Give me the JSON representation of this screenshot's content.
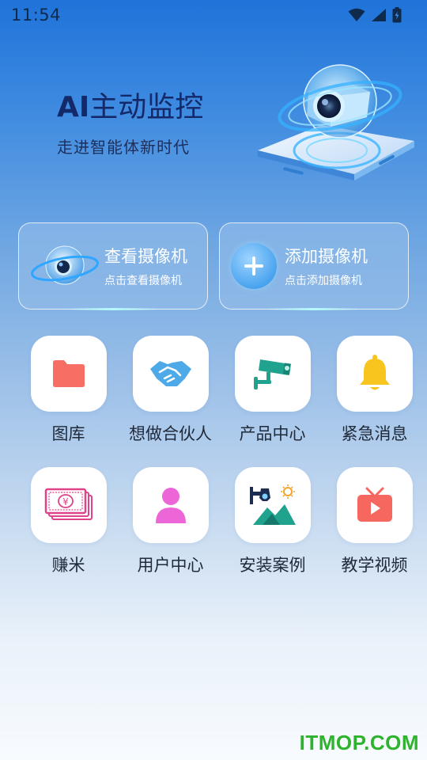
{
  "status_bar": {
    "time": "11:54"
  },
  "hero": {
    "title_ai": "AI",
    "title_rest": "主动监控",
    "subtitle": "走进智能体新时代"
  },
  "cards": {
    "view": {
      "title": "查看摄像机",
      "subtitle": "点击查看摄像机"
    },
    "add": {
      "title": "添加摄像机",
      "subtitle": "点击添加摄像机"
    }
  },
  "grid": {
    "items": [
      {
        "label": "图库",
        "icon": "folder-icon"
      },
      {
        "label": "想做合伙人",
        "icon": "handshake-icon"
      },
      {
        "label": "产品中心",
        "icon": "cctv-camera-icon"
      },
      {
        "label": "紧急消息",
        "icon": "bell-icon"
      },
      {
        "label": "赚米",
        "icon": "money-icon"
      },
      {
        "label": "用户中心",
        "icon": "user-icon"
      },
      {
        "label": "安装案例",
        "icon": "install-case-icon"
      },
      {
        "label": "教学视频",
        "icon": "video-icon"
      }
    ]
  },
  "watermark": "ITMOP.COM",
  "colors": {
    "folder": "#f76e65",
    "handshake": "#4ea9e8",
    "cctv": "#1fa38f",
    "bell": "#f7c51e",
    "money": "#e0438a",
    "user": "#ec66d8",
    "video": "#f5675f",
    "watermark": "#2db32d"
  }
}
